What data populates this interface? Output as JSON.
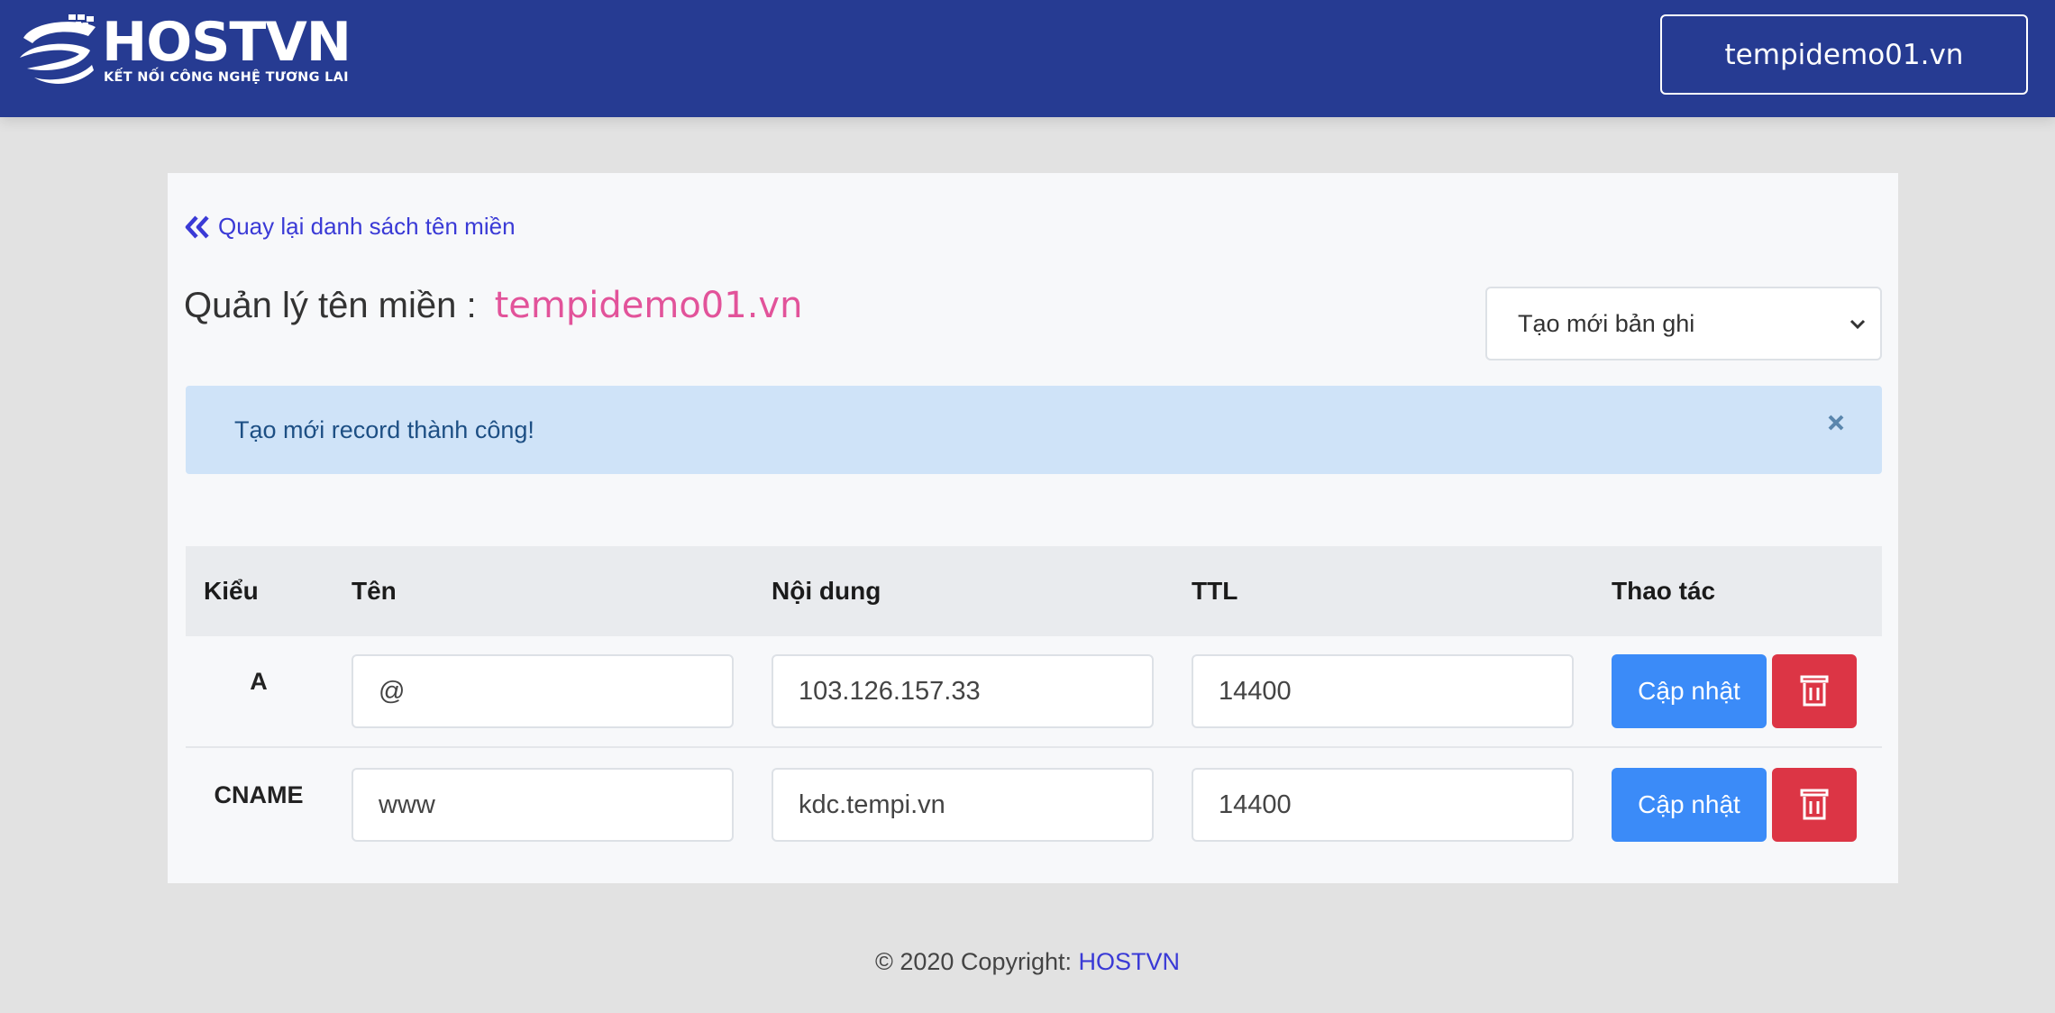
{
  "header": {
    "logo_text": "HOSTVN",
    "logo_tagline": "KẾT NỐI CÔNG NGHỆ TƯƠNG LAI",
    "domain_button": "tempidemo01.vn"
  },
  "back_link": {
    "label": "Quay lại danh sách tên miền",
    "icon": "double-chevron-left-icon"
  },
  "title": {
    "label": "Quản lý tên miền :",
    "domain": "tempidemo01.vn"
  },
  "record_select": {
    "selected": "Tạo mới bản ghi"
  },
  "alert": {
    "message": "Tạo mới record thành công!",
    "close_icon": "close-icon"
  },
  "table": {
    "headers": [
      "Kiểu",
      "Tên",
      "Nội dung",
      "TTL",
      "Thao tác"
    ],
    "rows": [
      {
        "type": "A",
        "name": "@",
        "content": "103.126.157.33",
        "ttl": "14400",
        "update_label": "Cập nhật"
      },
      {
        "type": "CNAME",
        "name": "www",
        "content": "kdc.tempi.vn",
        "ttl": "14400",
        "update_label": "Cập nhật"
      }
    ]
  },
  "footer": {
    "text": "© 2020 Copyright: ",
    "link": "HOSTVN"
  },
  "colors": {
    "header_bg": "#263b92",
    "accent_link": "#3a3ad6",
    "domain_pink": "#e2539a",
    "primary_button": "#3b8bf8",
    "danger_button": "#dc3545",
    "alert_bg": "#cfe3f8"
  }
}
